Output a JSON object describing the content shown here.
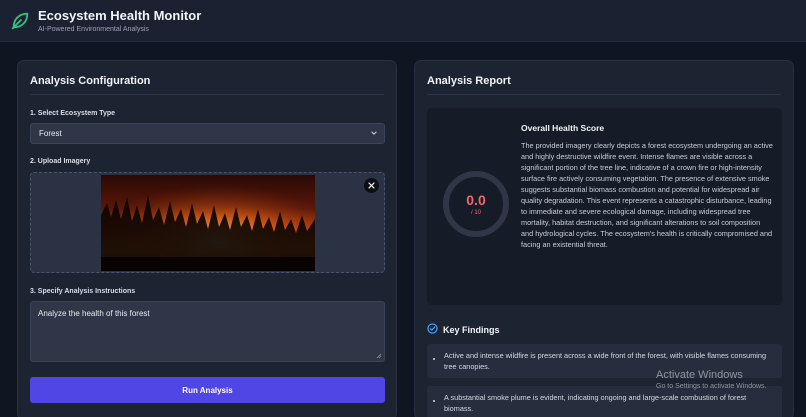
{
  "header": {
    "title": "Ecosystem Health Monitor",
    "subtitle": "AI-Powered Environmental Analysis",
    "logo_icon": "leaf-icon"
  },
  "config": {
    "title": "Analysis Configuration",
    "step1_label": "1. Select Ecosystem Type",
    "ecosystem_value": "Forest",
    "step2_label": "2. Upload Imagery",
    "image_icon": "forest-fire-image",
    "step3_label": "3. Specify Analysis Instructions",
    "instructions_value": "Analyze the health of this forest",
    "run_label": "Run Analysis"
  },
  "report": {
    "title": "Analysis Report",
    "score_title": "Overall Health Score",
    "score_value": "0.0",
    "score_max": "/ 10",
    "score_fraction": 0.0,
    "score_text": "The provided imagery clearly depicts a forest ecosystem undergoing an active and highly destructive wildfire event. Intense flames are visible across a significant portion of the tree line, indicative of a crown fire or high-intensity surface fire actively consuming vegetation. The presence of extensive smoke suggests substantial biomass combustion and potential for widespread air quality degradation. This event represents a catastrophic disturbance, leading to immediate and severe ecological damage, including widespread tree mortality, habitat destruction, and significant alterations to soil composition and hydrological cycles. The ecosystem's health is critically compromised and facing an existential threat.",
    "findings_title": "Key Findings",
    "findings": [
      "Active and intense wildfire is present across a wide front of the forest, with visible flames consuming tree canopies.",
      "A substantial smoke plume is evident, indicating ongoing and large-scale combustion of forest biomass."
    ]
  },
  "watermark": {
    "title": "Activate Windows",
    "subtitle": "Go to Settings to activate Windows."
  },
  "colors": {
    "accent": "#5046e6",
    "score": "#ee6a6a",
    "leaf": "#2ec27e",
    "check": "#4aa8ff"
  }
}
